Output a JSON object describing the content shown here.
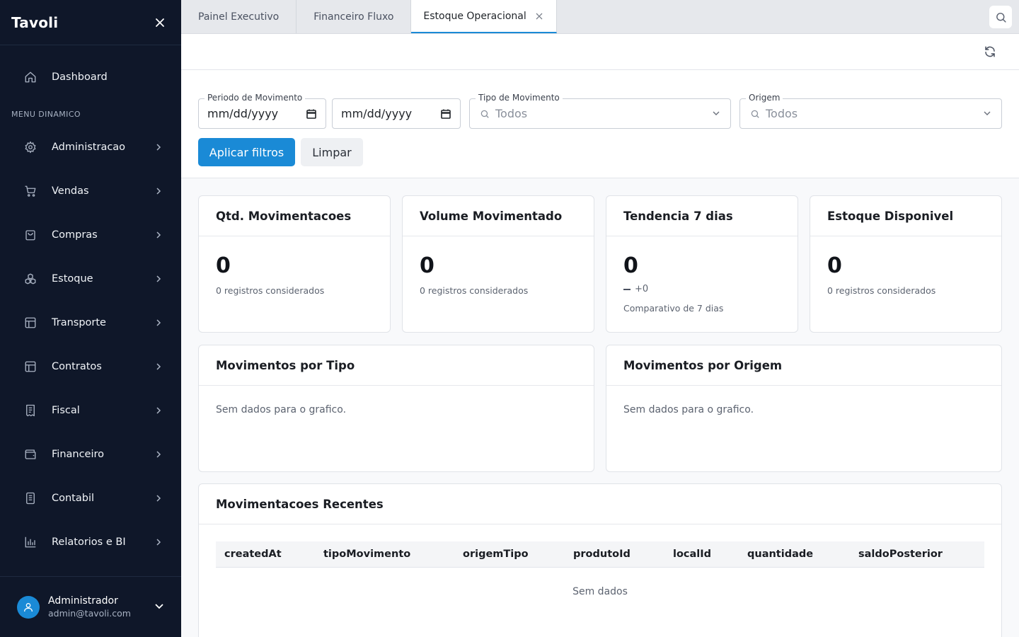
{
  "sidebar": {
    "brand": "Tavoli",
    "dashboard_label": "Dashboard",
    "section_label": "MENU DINAMICO",
    "items": [
      {
        "label": "Administracao",
        "icon": "gear-icon"
      },
      {
        "label": "Vendas",
        "icon": "cart-icon"
      },
      {
        "label": "Compras",
        "icon": "shopping-bag-icon"
      },
      {
        "label": "Estoque",
        "icon": "boxes-icon"
      },
      {
        "label": "Transporte",
        "icon": "layout-icon"
      },
      {
        "label": "Contratos",
        "icon": "layout-icon"
      },
      {
        "label": "Fiscal",
        "icon": "receipt-icon"
      },
      {
        "label": "Financeiro",
        "icon": "wallet-icon"
      },
      {
        "label": "Contabil",
        "icon": "notebook-icon"
      },
      {
        "label": "Relatorios e BI",
        "icon": "bar-chart-icon"
      }
    ],
    "user": {
      "name": "Administrador",
      "email": "admin@tavoli.com"
    }
  },
  "tabs": [
    {
      "label": "Painel Executivo",
      "active": false
    },
    {
      "label": "Financeiro Fluxo",
      "active": false
    },
    {
      "label": "Estoque Operacional",
      "active": true
    }
  ],
  "filters": {
    "period_label": "Periodo de Movimento",
    "date_start_placeholder": "mm/dd/yyyy",
    "date_end_placeholder": "mm/dd/yyyy",
    "tipo_label": "Tipo de Movimento",
    "tipo_value": "Todos",
    "origem_label": "Origem",
    "origem_value": "Todos",
    "apply_label": "Aplicar filtros",
    "clear_label": "Limpar"
  },
  "kpis": [
    {
      "title": "Qtd. Movimentacoes",
      "value": "0",
      "sub": "0 registros considerados"
    },
    {
      "title": "Volume Movimentado",
      "value": "0",
      "sub": "0 registros considerados"
    },
    {
      "title": "Tendencia 7 dias",
      "value": "0",
      "delta": "+0",
      "compare": "Comparativo de 7 dias"
    },
    {
      "title": "Estoque Disponivel",
      "value": "0",
      "sub": "0 registros considerados"
    }
  ],
  "charts": [
    {
      "title": "Movimentos por Tipo",
      "empty": "Sem dados para o grafico."
    },
    {
      "title": "Movimentos por Origem",
      "empty": "Sem dados para o grafico."
    }
  ],
  "recent": {
    "title": "Movimentacoes Recentes",
    "columns": [
      "createdAt",
      "tipoMovimento",
      "origemTipo",
      "produtoId",
      "localId",
      "quantidade",
      "saldoPosterior"
    ],
    "empty": "Sem dados"
  },
  "colors": {
    "sidebar_bg": "#0f1729",
    "accent": "#1a8ad6"
  }
}
